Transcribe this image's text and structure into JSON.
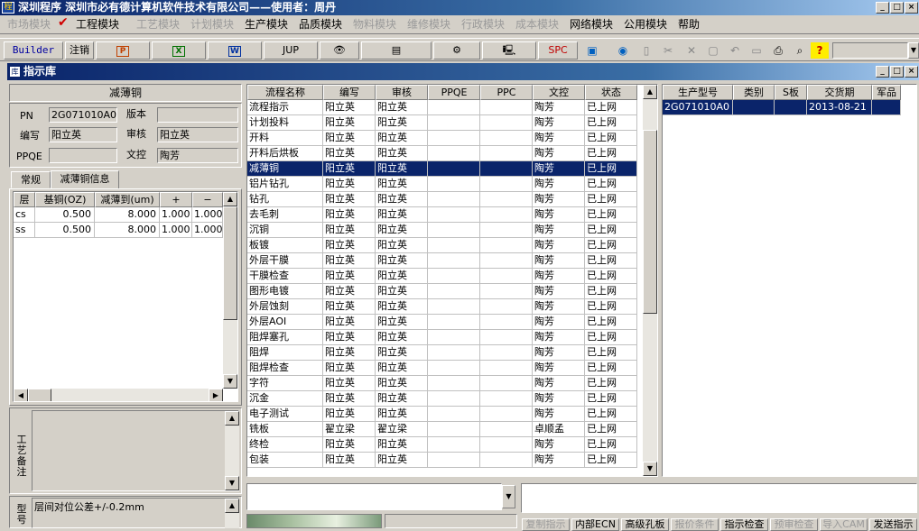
{
  "window": {
    "app_icon": "程",
    "title": "深圳程序    深圳市必有德计算机软件技术有限公司——使用者：周丹"
  },
  "menu": [
    {
      "label": "市场模块",
      "enabled": false
    },
    {
      "label": "✔",
      "enabled": true
    },
    {
      "label": "工程模块",
      "enabled": true
    },
    {
      "label": "工艺模块",
      "enabled": false
    },
    {
      "label": "计划模块",
      "enabled": false
    },
    {
      "label": "生产模块",
      "enabled": true
    },
    {
      "label": "品质模块",
      "enabled": true
    },
    {
      "label": "物料模块",
      "enabled": false
    },
    {
      "label": "维修模块",
      "enabled": false
    },
    {
      "label": "行政模块",
      "enabled": false
    },
    {
      "label": "成本模块",
      "enabled": false
    },
    {
      "label": "网络模块",
      "enabled": true
    },
    {
      "label": "公用模块",
      "enabled": true
    },
    {
      "label": "帮助",
      "enabled": true
    }
  ],
  "toolbar": {
    "builder": "Builder",
    "logout": "注销",
    "jup": "JUP",
    "spc": "SPC",
    "dropdown_value": ""
  },
  "subwindow": {
    "icon": "库",
    "title": "指示库"
  },
  "left": {
    "header": "减薄铜",
    "pn_label": "PN",
    "pn_value": "2G071010A0",
    "version_label": "版本",
    "version_value": "",
    "author_label": "编写",
    "author_value": "阳立英",
    "review_label": "审核",
    "review_value": "阳立英",
    "ppqe_label": "PPQE",
    "ppqe_value": "",
    "doc_label": "文控",
    "doc_value": "陶芳",
    "tabs": [
      "常规",
      "减薄铜信息"
    ],
    "columns": [
      "层",
      "基铜(OZ)",
      "减薄到(um)",
      "+",
      "−"
    ],
    "rows": [
      [
        "cs",
        "0.500",
        "8.000",
        "1.000",
        "1.000"
      ],
      [
        "ss",
        "0.500",
        "8.000",
        "1.000",
        "1.000"
      ]
    ],
    "note1_label": "工艺备注",
    "note1_value": "",
    "note2_label": "型号",
    "note2_value": "层间对位公差+/-0.2mm"
  },
  "flow": {
    "columns": [
      "流程名称",
      "编写",
      "审核",
      "PPQE",
      "PPC",
      "文控",
      "状态"
    ],
    "rows": [
      [
        "流程指示",
        "阳立英",
        "阳立英",
        "",
        "",
        "陶芳",
        "已上网"
      ],
      [
        "计划投料",
        "阳立英",
        "阳立英",
        "",
        "",
        "陶芳",
        "已上网"
      ],
      [
        "开料",
        "阳立英",
        "阳立英",
        "",
        "",
        "陶芳",
        "已上网"
      ],
      [
        "开料后烘板",
        "阳立英",
        "阳立英",
        "",
        "",
        "陶芳",
        "已上网"
      ],
      [
        "减薄铜",
        "阳立英",
        "阳立英",
        "",
        "",
        "陶芳",
        "已上网"
      ],
      [
        "铝片钻孔",
        "阳立英",
        "阳立英",
        "",
        "",
        "陶芳",
        "已上网"
      ],
      [
        "钻孔",
        "阳立英",
        "阳立英",
        "",
        "",
        "陶芳",
        "已上网"
      ],
      [
        "去毛刺",
        "阳立英",
        "阳立英",
        "",
        "",
        "陶芳",
        "已上网"
      ],
      [
        "沉铜",
        "阳立英",
        "阳立英",
        "",
        "",
        "陶芳",
        "已上网"
      ],
      [
        "板镀",
        "阳立英",
        "阳立英",
        "",
        "",
        "陶芳",
        "已上网"
      ],
      [
        "外层干膜",
        "阳立英",
        "阳立英",
        "",
        "",
        "陶芳",
        "已上网"
      ],
      [
        "干膜检查",
        "阳立英",
        "阳立英",
        "",
        "",
        "陶芳",
        "已上网"
      ],
      [
        "图形电镀",
        "阳立英",
        "阳立英",
        "",
        "",
        "陶芳",
        "已上网"
      ],
      [
        "外层蚀刻",
        "阳立英",
        "阳立英",
        "",
        "",
        "陶芳",
        "已上网"
      ],
      [
        "外层AOI",
        "阳立英",
        "阳立英",
        "",
        "",
        "陶芳",
        "已上网"
      ],
      [
        "阻焊塞孔",
        "阳立英",
        "阳立英",
        "",
        "",
        "陶芳",
        "已上网"
      ],
      [
        "阻焊",
        "阳立英",
        "阳立英",
        "",
        "",
        "陶芳",
        "已上网"
      ],
      [
        "阻焊检查",
        "阳立英",
        "阳立英",
        "",
        "",
        "陶芳",
        "已上网"
      ],
      [
        "字符",
        "阳立英",
        "阳立英",
        "",
        "",
        "陶芳",
        "已上网"
      ],
      [
        "沉金",
        "阳立英",
        "阳立英",
        "",
        "",
        "陶芳",
        "已上网"
      ],
      [
        "电子测试",
        "阳立英",
        "阳立英",
        "",
        "",
        "陶芳",
        "已上网"
      ],
      [
        "铣板",
        "翟立梁",
        "翟立梁",
        "",
        "",
        "卓顺孟",
        "已上网"
      ],
      [
        "终检",
        "阳立英",
        "阳立英",
        "",
        "",
        "陶芳",
        "已上网"
      ],
      [
        "包装",
        "阳立英",
        "阳立英",
        "",
        "",
        "陶芳",
        "已上网"
      ]
    ],
    "selected_index": 4
  },
  "orders": {
    "columns": [
      "生产型号",
      "类别",
      "S板",
      "交货期",
      "军品"
    ],
    "rows": [
      [
        "2G071010A0",
        "",
        "",
        "2013-08-21",
        ""
      ]
    ]
  },
  "bottom_buttons": [
    {
      "label": "复制指示",
      "enabled": false
    },
    {
      "label": "内部ECN",
      "enabled": true
    },
    {
      "label": "高级孔板",
      "enabled": true
    },
    {
      "label": "报价条件",
      "enabled": false
    },
    {
      "label": "指示检查",
      "enabled": true
    },
    {
      "label": "预审检查",
      "enabled": false
    },
    {
      "label": "导入CAM",
      "enabled": false
    },
    {
      "label": "发送指示",
      "enabled": true
    }
  ],
  "colors": {
    "title_blue": "#0a246a",
    "selection": "#0a246a",
    "check_red": "#d00000"
  }
}
